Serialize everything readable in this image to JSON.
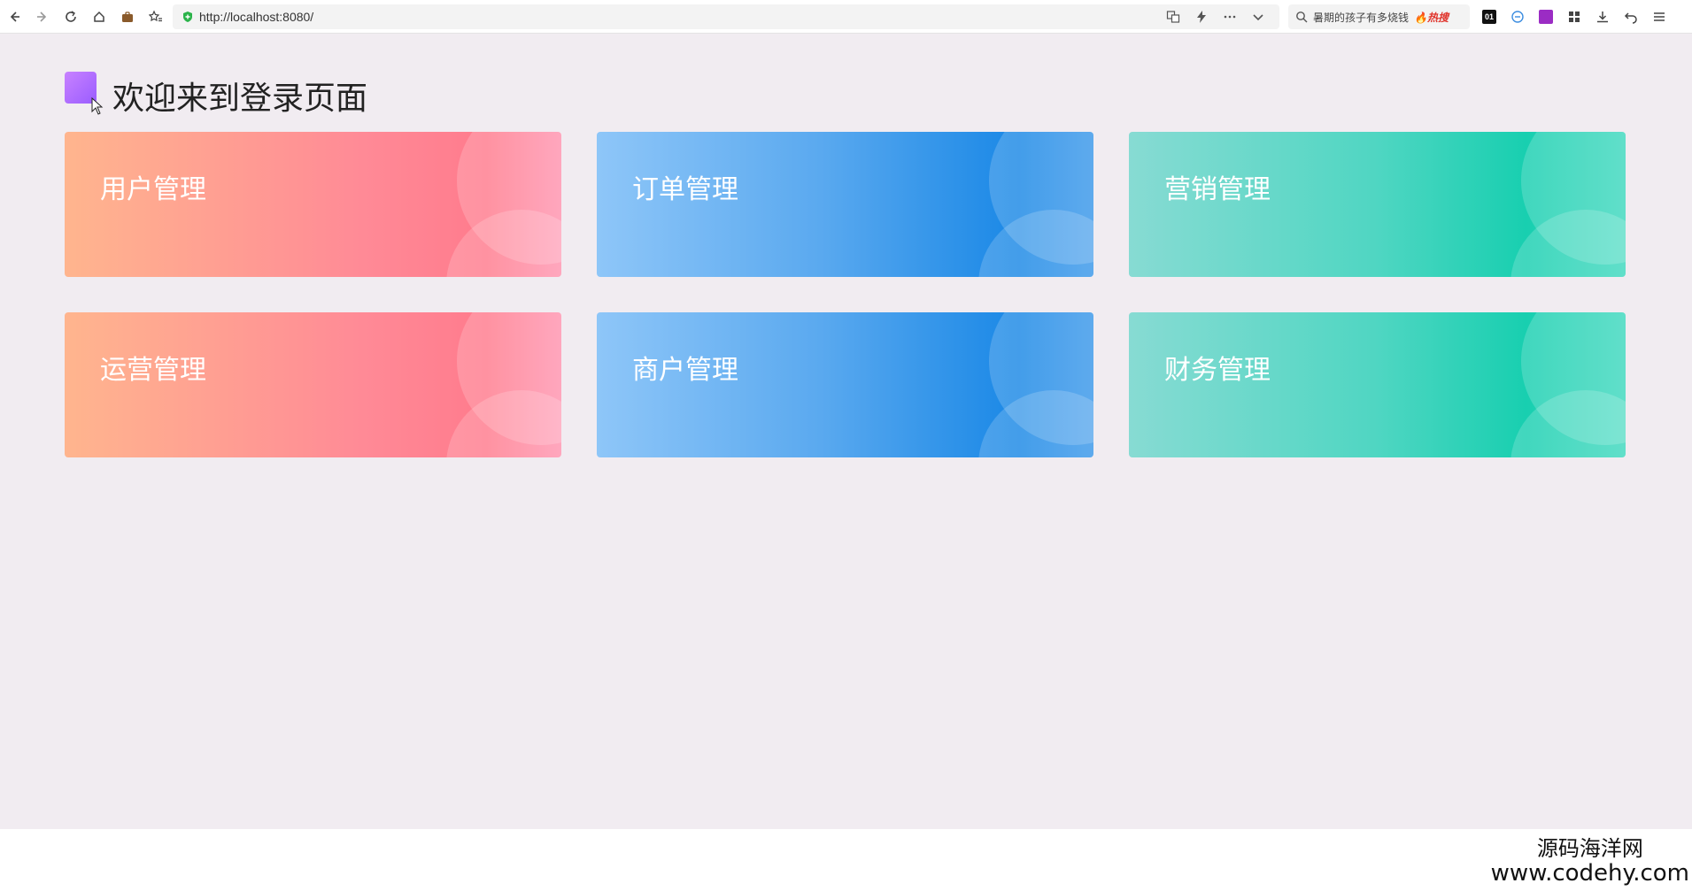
{
  "browser": {
    "url": "http://localhost:8080/",
    "search_text": "暑期的孩子有多烧钱",
    "search_hot_label": "热搜",
    "extension_label": "01"
  },
  "page": {
    "title": "欢迎来到登录页面",
    "cards": [
      {
        "label": "用户管理",
        "color": "pink"
      },
      {
        "label": "订单管理",
        "color": "blue"
      },
      {
        "label": "营销管理",
        "color": "teal"
      },
      {
        "label": "运营管理",
        "color": "pink"
      },
      {
        "label": "商户管理",
        "color": "blue"
      },
      {
        "label": "财务管理",
        "color": "teal"
      }
    ]
  },
  "watermark": {
    "line1": "源码海洋网",
    "line2": "www.codehy.com"
  },
  "colors": {
    "page_bg": "#f1ecf1",
    "logo_accent": "#b070ff",
    "pink": "#ff8a96",
    "blue": "#1a88e6",
    "teal": "#18cfb0"
  }
}
